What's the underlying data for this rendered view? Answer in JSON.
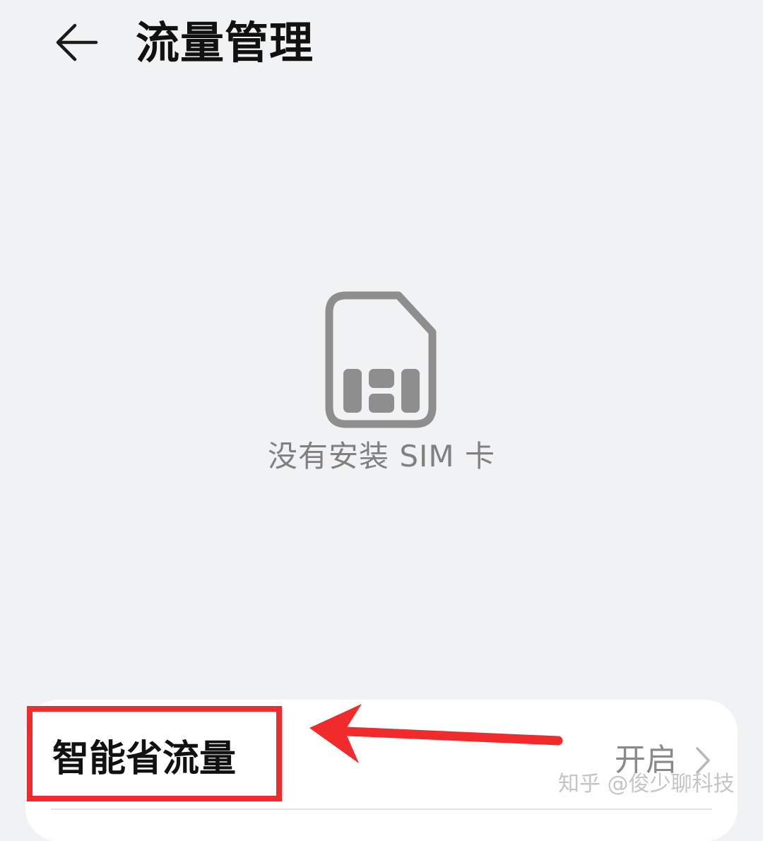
{
  "header": {
    "back_icon": "arrow-left-icon",
    "title": "流量管理"
  },
  "empty_state": {
    "icon": "sim-card-icon",
    "message": "没有安装 SIM 卡"
  },
  "settings": {
    "items": [
      {
        "label": "智能省流量",
        "value": "开启",
        "icon": "chevron-right-icon"
      }
    ]
  },
  "annotation": {
    "highlight_color": "#f12b2b",
    "arrow_color": "#f12b2b"
  },
  "watermark": "知乎 @俊少聊科技",
  "colors": {
    "background": "#f1f2f4",
    "card": "#ffffff",
    "icon_gray": "#8e8e8e"
  }
}
